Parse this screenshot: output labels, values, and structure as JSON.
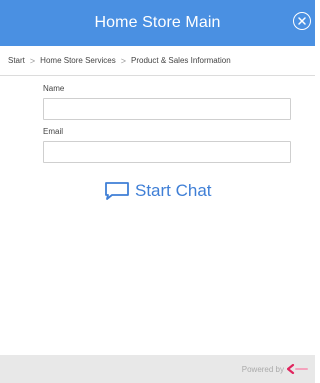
{
  "header": {
    "title": "Home Store Main",
    "background_color": "#4a90e2",
    "close_icon": "close-circle-icon"
  },
  "breadcrumb": {
    "items": [
      "Start",
      "Home Store Services",
      "Product & Sales Information"
    ],
    "separator": ">"
  },
  "form": {
    "name_label": "Name",
    "name_value": "",
    "email_label": "Email",
    "email_value": ""
  },
  "chat": {
    "label": "Start Chat",
    "icon": "chat-bubble-icon",
    "color": "#3f7fd6"
  },
  "footer": {
    "powered_label": "Powered by",
    "brand_color": "#e0245e"
  }
}
